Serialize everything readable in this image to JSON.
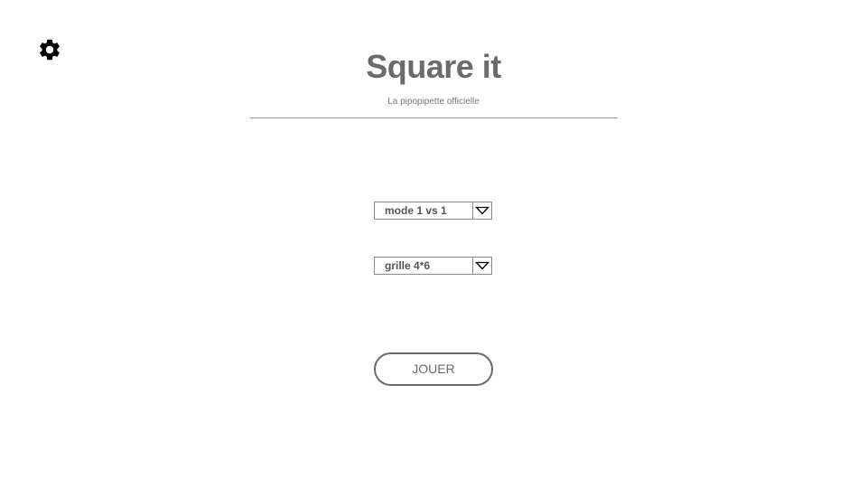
{
  "header": {
    "title": "Square it",
    "subtitle": "La pipopipette officielle"
  },
  "settings": {
    "icon": "gear-icon"
  },
  "selects": {
    "mode": {
      "value": "mode 1 vs 1",
      "icon": "triangle-down-icon"
    },
    "grid": {
      "value": "grille 4*6",
      "icon": "triangle-down-icon"
    }
  },
  "play_button": {
    "label": "JOUER"
  },
  "colors": {
    "text": "#6b6b6b",
    "border": "#8a8a8a",
    "icon": "#000000"
  }
}
